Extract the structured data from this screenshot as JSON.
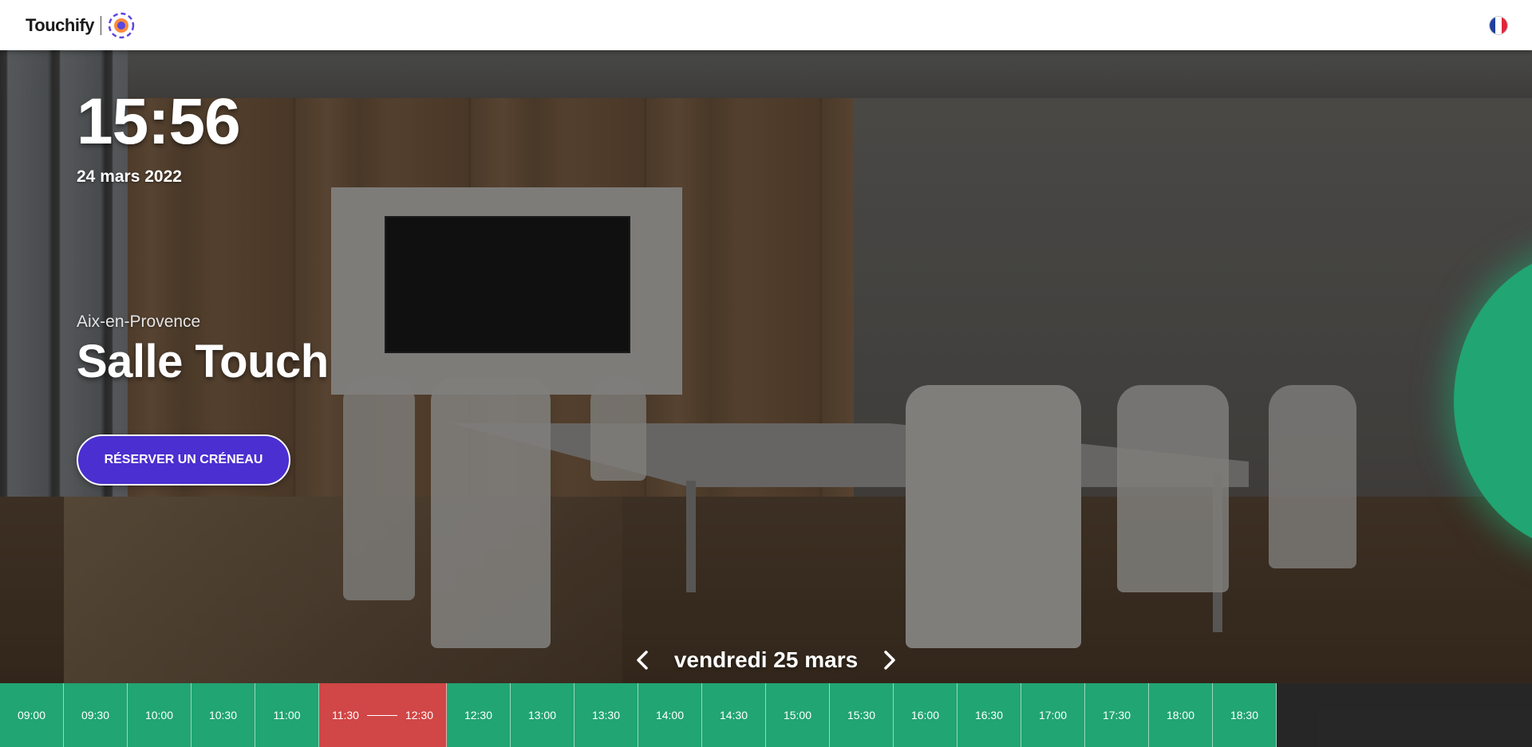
{
  "header": {
    "brand": "Touchify",
    "language_icon": "france-flag-icon"
  },
  "room": {
    "time": "15:56",
    "date": "24 mars 2022",
    "location": "Aix-en-Provence",
    "name": "Salle Touch",
    "book_label": "RÉSERVER UN CRÉNEAU"
  },
  "day_nav": {
    "label": "vendredi 25 mars",
    "prev_icon": "chevron-left-icon",
    "next_icon": "chevron-right-icon"
  },
  "colors": {
    "accent_green": "#21a572",
    "busy_red": "#d14646",
    "button_purple": "#4b2fd0"
  },
  "timeline": {
    "before": [
      "09:00",
      "09:30",
      "10:00",
      "10:30",
      "11:00"
    ],
    "busy": {
      "start": "11:30",
      "end": "12:30"
    },
    "after": [
      "12:30",
      "13:00",
      "13:30",
      "14:00",
      "14:30",
      "15:00",
      "15:30",
      "16:00",
      "16:30",
      "17:00",
      "17:30",
      "18:00",
      "18:30"
    ]
  }
}
